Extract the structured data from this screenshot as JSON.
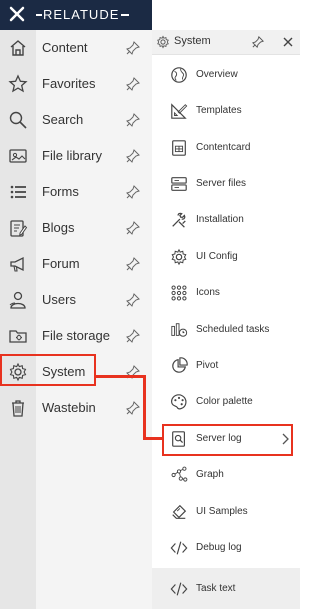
{
  "app": {
    "brand": "RELATUDE"
  },
  "main_nav": {
    "items": [
      {
        "label": "Content",
        "icon": "house-icon"
      },
      {
        "label": "Favorites",
        "icon": "star-icon"
      },
      {
        "label": "Search",
        "icon": "magnifier-icon"
      },
      {
        "label": "File library",
        "icon": "image-card-icon"
      },
      {
        "label": "Forms",
        "icon": "list-icon"
      },
      {
        "label": "Blogs",
        "icon": "blog-edit-icon"
      },
      {
        "label": "Forum",
        "icon": "megaphone-icon"
      },
      {
        "label": "Users",
        "icon": "users-icon"
      },
      {
        "label": "File storage",
        "icon": "folder-gear-icon"
      },
      {
        "label": "System",
        "icon": "gear-icon"
      },
      {
        "label": "Wastebin",
        "icon": "trash-icon"
      }
    ],
    "highlighted": "System"
  },
  "submenu": {
    "title": "System",
    "items": [
      {
        "label": "Overview",
        "icon": "globe-icon"
      },
      {
        "label": "Templates",
        "icon": "ruler-pencil-icon"
      },
      {
        "label": "Contentcard",
        "icon": "card-grid-icon"
      },
      {
        "label": "Server files",
        "icon": "server-icon"
      },
      {
        "label": "Installation",
        "icon": "tools-icon"
      },
      {
        "label": "UI Config",
        "icon": "gear-icon"
      },
      {
        "label": "Icons",
        "icon": "dots-grid-icon"
      },
      {
        "label": "Scheduled tasks",
        "icon": "scheduled-tasks-icon"
      },
      {
        "label": "Pivot",
        "icon": "pie-chart-icon"
      },
      {
        "label": "Color palette",
        "icon": "palette-icon"
      },
      {
        "label": "Server log",
        "icon": "log-search-icon",
        "has_submenu": true
      },
      {
        "label": "Graph",
        "icon": "graph-nodes-icon"
      },
      {
        "label": "UI Samples",
        "icon": "samples-icon"
      },
      {
        "label": "Debug log",
        "icon": "code-icon"
      }
    ],
    "footer": {
      "label": "Task text",
      "icon": "code-icon"
    },
    "highlighted": "Server log"
  },
  "colors": {
    "topbar": "#1b2a44",
    "highlight": "#e8321f"
  }
}
